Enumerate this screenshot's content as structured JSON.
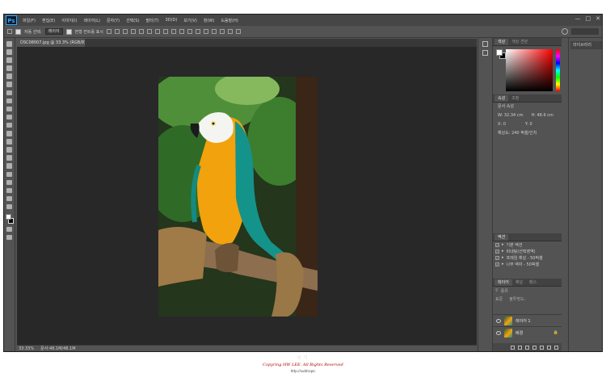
{
  "app": {
    "logo": "Ps",
    "menus": [
      "파일(F)",
      "편집(E)",
      "이미지(I)",
      "레이어(L)",
      "문자(Y)",
      "선택(S)",
      "필터(T)",
      "3D(D)",
      "보기(V)",
      "창(W)",
      "도움말(H)"
    ]
  },
  "options": {
    "auto_select_label": "자동 선택:",
    "auto_select_value": "레이어",
    "transform_label": "변형 컨트롤 표시"
  },
  "document": {
    "tab_title": "DSC08007.jpg @ 33.3% (RGB/8) *",
    "zoom": "33.33%",
    "doc_size": "문서:48.1M/48.1M"
  },
  "color_panel": {
    "tabs": [
      "색상",
      "색상 견본"
    ],
    "fg_color": "#ffffff",
    "bg_color": "#000000"
  },
  "properties": {
    "tabs": [
      "속성",
      "조정"
    ],
    "title": "문서 속성",
    "width": "W: 32.34 cm",
    "height": "H: 48.6 cm",
    "x": "X: 0",
    "y": "Y: 0",
    "resolution": "해상도: 240 픽셀/인치"
  },
  "actions": {
    "title": "액션",
    "rows": [
      "기본 액션",
      "비네팅(선택영역)",
      "프레임 채널 - 50픽셀",
      "나무 액자 - 50픽셀"
    ]
  },
  "layers": {
    "tabs": [
      "레이어",
      "채널",
      "패스"
    ],
    "kind_filter": "종류",
    "blend_mode": "표준",
    "opacity": "불투명도:",
    "items": [
      {
        "name": "레이어 1"
      },
      {
        "name": "배경"
      }
    ]
  },
  "right_panel": {
    "library_label": "라이브러리"
  },
  "footer": {
    "watermark": "보기",
    "copyright": "Copyring HW LEE. All Rights Reserved",
    "url": "http://subtropic"
  }
}
